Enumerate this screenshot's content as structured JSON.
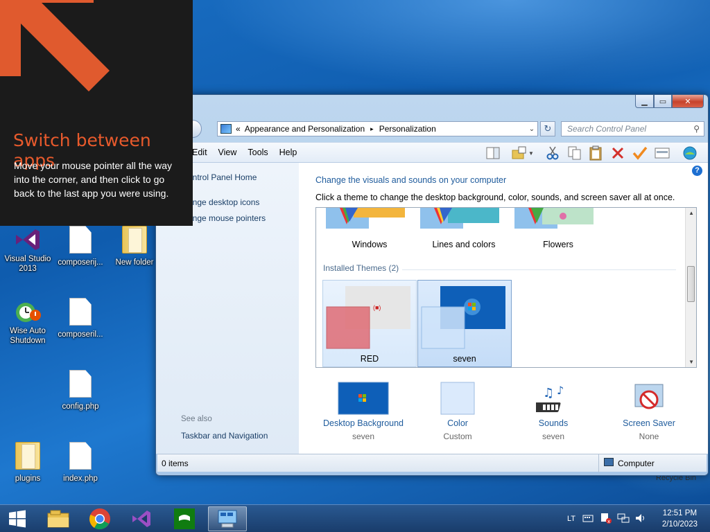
{
  "tip": {
    "title": "Switch between apps",
    "body": "Move your mouse pointer all the way into the corner, and then click to go back to the last app you were using."
  },
  "desktop": {
    "icons": [
      {
        "label": "Visual Studio 2013"
      },
      {
        "label": "composerij..."
      },
      {
        "label": "New folder"
      },
      {
        "label": "Wise Auto Shutdown"
      },
      {
        "label": "composeril..."
      },
      {
        "label": "config.php"
      },
      {
        "label": "plugins"
      },
      {
        "label": "index.php"
      }
    ],
    "recycle_bin": "Recycle Bin"
  },
  "window": {
    "breadcrumb": {
      "root_sep": "«",
      "item1": "Appearance and Personalization",
      "sep": "▸",
      "item2": "Personalization"
    },
    "search_placeholder": "Search Control Panel",
    "menu": [
      "Edit",
      "View",
      "Tools",
      "Help"
    ],
    "left_links": {
      "home": "ontrol Panel Home",
      "desktop_icons": "ange desktop icons",
      "mouse_pointers": "ange mouse pointers",
      "see_also": "See also",
      "taskbar_nav": "Taskbar and Navigation"
    },
    "heading": "Change the visuals and sounds on your computer",
    "subheading": "Click a theme to change the desktop background, color, sounds, and screen saver all at once.",
    "themes_top": [
      "Windows",
      "Lines and colors",
      "Flowers"
    ],
    "installed_header": "Installed Themes (2)",
    "installed": [
      "RED",
      "seven"
    ],
    "bottom": [
      {
        "label": "Desktop Background",
        "sub": "seven"
      },
      {
        "label": "Color",
        "sub": "Custom"
      },
      {
        "label": "Sounds",
        "sub": "seven"
      },
      {
        "label": "Screen Saver",
        "sub": "None"
      }
    ],
    "status_left": "0 items",
    "status_right": "Computer"
  },
  "taskbar": {
    "lang": "LT",
    "time": "12:51 PM",
    "date": "2/10/2023"
  },
  "colors": {
    "tip_accent": "#e85a2c",
    "link": "#1e5b9c"
  }
}
